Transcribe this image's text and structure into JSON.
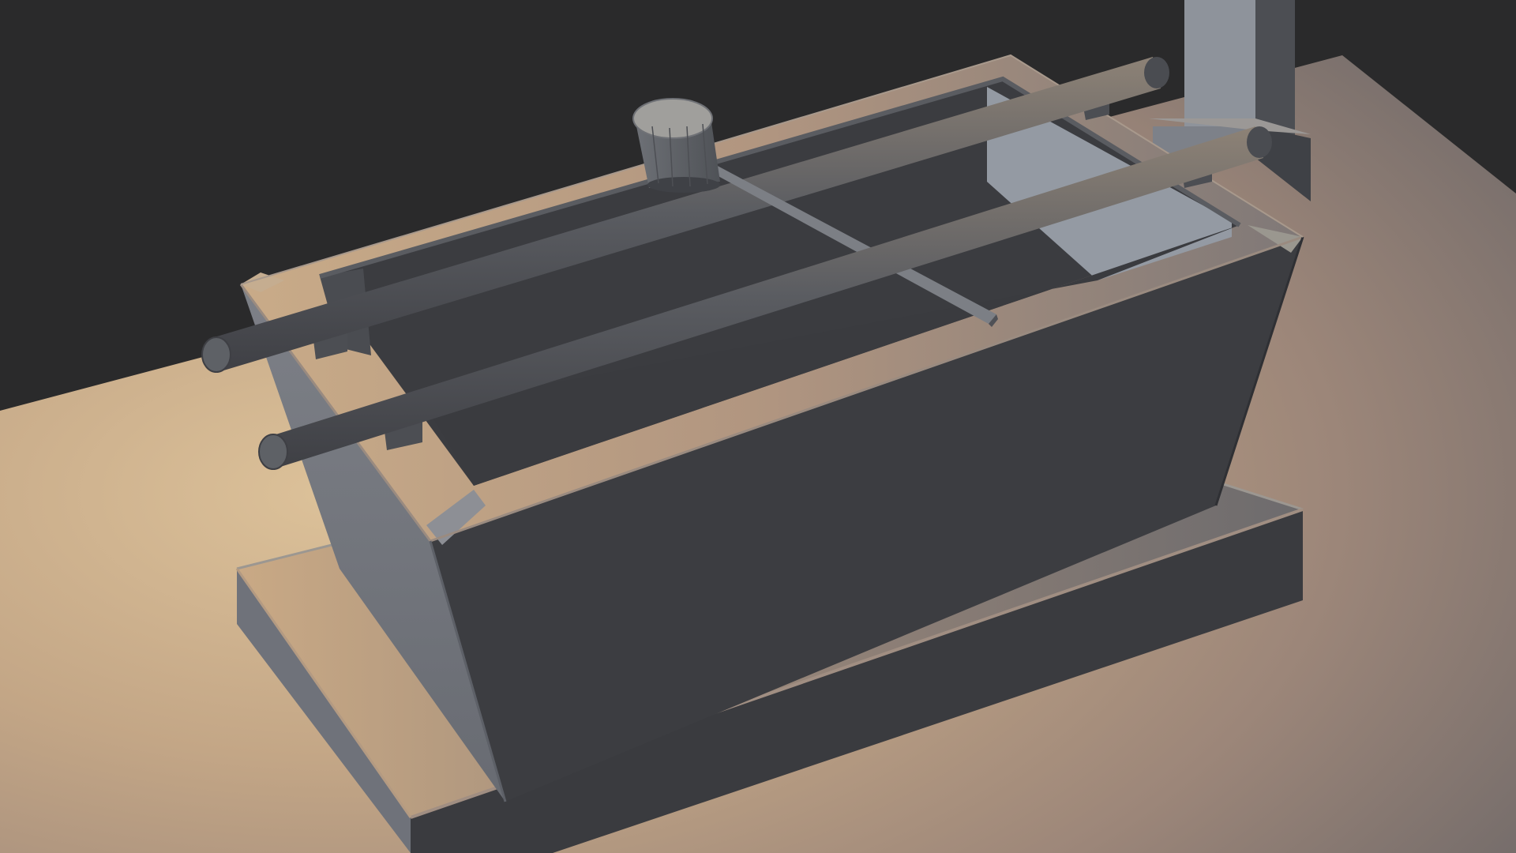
{
  "viewport": {
    "shading": "solid",
    "colors": {
      "background": "#2a2a2b",
      "floor_light": "#d9bd94",
      "floor_mid": "#a9927f",
      "floor_dark": "#6f6b6a",
      "stone_side": "#76797f",
      "stone_front": "#3d3e42",
      "stone_top": "#8e8a85",
      "pole": "#55585d",
      "ladle": "#6b6e73"
    }
  },
  "scene": {
    "objects": [
      {
        "name": "chozubachi-basin",
        "kind": "mesh"
      },
      {
        "name": "basin-plinth",
        "kind": "mesh"
      },
      {
        "name": "ladle-rest-pole-back",
        "kind": "mesh"
      },
      {
        "name": "ladle-rest-pole-front",
        "kind": "mesh"
      },
      {
        "name": "hishaku-ladle-cup",
        "kind": "mesh"
      },
      {
        "name": "hishaku-ladle-handle",
        "kind": "mesh"
      },
      {
        "name": "pillar",
        "kind": "mesh"
      },
      {
        "name": "ground-plane",
        "kind": "mesh"
      }
    ]
  }
}
